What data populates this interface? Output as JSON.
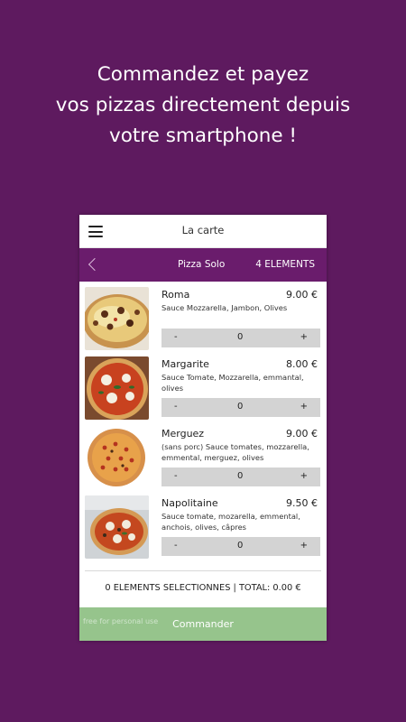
{
  "headline": {
    "line1": "Commandez et payez",
    "line2": "vos pizzas directement depuis",
    "line3": "votre smartphone !"
  },
  "appbar": {
    "menu_icon": "hamburger-menu-icon",
    "title": "La carte"
  },
  "subbar": {
    "back_icon": "chevron-left-icon",
    "category": "Pizza Solo",
    "count": "4 ELEMENTS"
  },
  "items": [
    {
      "name": "Roma",
      "price": "9.00 €",
      "description": "Sauce Mozzarella, Jambon, Olives",
      "minus": "-",
      "qty": "0",
      "plus": "+"
    },
    {
      "name": "Margarite",
      "price": "8.00 €",
      "description": "Sauce Tomate, Mozzarella, emmantal, olives",
      "minus": "-",
      "qty": "0",
      "plus": "+"
    },
    {
      "name": "Merguez",
      "price": "9.00 €",
      "description": "(sans porc) Sauce tomates, mozzarella, emmental, merguez, olives",
      "minus": "-",
      "qty": "0",
      "plus": "+"
    },
    {
      "name": "Napolitaine",
      "price": "9.50 €",
      "description": "Sauce tomate, mozarella, emmental, anchois, olives, câpres",
      "minus": "-",
      "qty": "0",
      "plus": "+"
    }
  ],
  "summary": "0 ELEMENTS SELECTIONNES | TOTAL: 0.00 €",
  "order_button": "Commander",
  "watermark": "free for personal use",
  "colors": {
    "background": "#5e1a5f",
    "subbar": "#6a1c6c",
    "order_button": "#96c48c",
    "stepper": "#d3d3d3"
  }
}
